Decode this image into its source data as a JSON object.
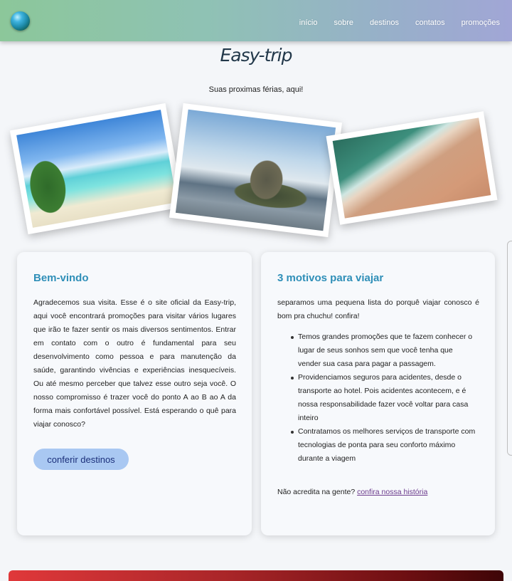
{
  "nav": {
    "links": [
      "início",
      "sobre",
      "destinos",
      "contatos",
      "promoções"
    ]
  },
  "hero": {
    "title": "Easy-trip",
    "subtitle": "Suas proximas férias, aqui!"
  },
  "welcome": {
    "heading": "Bem-vindo",
    "text": "Agradecemos sua visita. Esse é o site oficial da Easy-trip, aqui você encontrará promoções para visitar vários lugares que irão te fazer sentir os mais diversos sentimentos. Entrar em contato com o outro é fundamental para seu desenvolvimento como pessoa e para manutenção da saúde, garantindo vivências e experiências inesquecíveis. Ou até mesmo perceber que talvez esse outro seja você. O nosso compromisso é trazer você do ponto A ao B ao A da forma mais confortável possível. Está esperando o quê para viajar conosco?",
    "button": "conferir destinos"
  },
  "motives": {
    "heading": "3 motivos para viajar",
    "intro": "separamos uma pequena lista do porquê viajar conosco é bom pra chuchu! confira!",
    "items": [
      "Temos grandes promoções que te fazem conhecer o lugar de seus sonhos sem que você tenha que vender sua casa para pagar a passagem.",
      "Providenciamos seguros para acidentes, desde o transporte ao hotel. Pois acidentes acontecem, e é nossa responsabilidade fazer você voltar para casa inteiro",
      "Contratamos os melhores serviços de transporte com tecnologias de ponta para seu conforto máximo durante a viagem"
    ],
    "footer_text": "Não acredita na gente?",
    "footer_link": "confira nossa história"
  },
  "colors": {
    "heading": "#2f8fb8",
    "button_bg": "#a9c8f2",
    "link": "#6b3a8c",
    "bottom_bar": "#c0282b"
  }
}
